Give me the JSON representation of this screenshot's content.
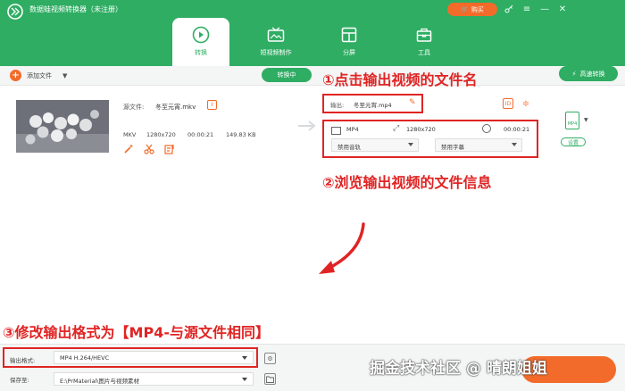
{
  "app": {
    "title": "数据蛙视频转换器（未注册）",
    "buy_label": "购买",
    "icons": [
      "key-icon",
      "menu-icon",
      "minimize-icon",
      "close-icon"
    ]
  },
  "tabs": [
    {
      "label": "转换",
      "icon": "convert-icon",
      "active": true
    },
    {
      "label": "短视频制作",
      "icon": "tv-icon",
      "active": false
    },
    {
      "label": "分屏",
      "icon": "split-screen-icon",
      "active": false
    },
    {
      "label": "工具",
      "icon": "toolbox-icon",
      "active": false
    }
  ],
  "toolbar": {
    "add_file_label": "添加文件",
    "converting_label": "转换中",
    "fast_convert_label": "高速转换"
  },
  "file": {
    "source_label": "源文件:",
    "source_name": "冬至元宵.mkv",
    "format": "MKV",
    "resolution": "1280x720",
    "duration": "00:00:21",
    "size": "149.83 KB"
  },
  "output": {
    "label": "输出:",
    "name": "冬至元宵.mp4",
    "format": "MP4",
    "resolution": "1280x720",
    "duration": "00:00:21",
    "audio_select": "禁用音轨",
    "subtitle_select": "禁用字幕",
    "mp4_badge": "MP4",
    "settings_label": "设置"
  },
  "annotations": {
    "step1": "①点击输出视频的文件名",
    "step2": "②浏览输出视频的文件信息",
    "step3": "③修改输出格式为【MP4-与源文件相同】"
  },
  "bottom": {
    "format_label": "输出格式:",
    "format_value": "MP4 H.264/HEVC",
    "save_label": "保存至:",
    "save_path": "E:\\PrMaterial\\图片与视频素材"
  },
  "watermark": "掘金技术社区 @ 晴朗姐姐",
  "colors": {
    "brand_green": "#2fad63",
    "accent_orange": "#f36b2a",
    "annotation_red": "#e02424"
  }
}
